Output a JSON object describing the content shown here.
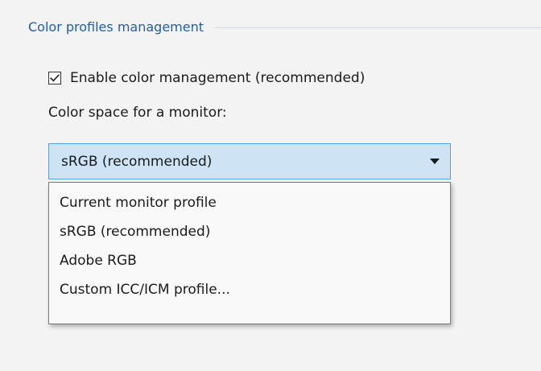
{
  "group": {
    "title": "Color profiles management"
  },
  "checkbox": {
    "label": "Enable color management (recommended)",
    "checked": true
  },
  "color_space": {
    "label": "Color space for a monitor:",
    "selected": "sRGB (recommended)",
    "options": [
      "Current monitor profile",
      "sRGB (recommended)",
      "Adobe RGB",
      "Custom ICC/ICM profile..."
    ]
  },
  "colors": {
    "accent_title": "#1f5fa8",
    "combo_background": "#cde4f7",
    "combo_border": "#5c9ed6",
    "background": "#f3f3f3"
  },
  "icons": {
    "checkbox": "checkmark-icon",
    "dropdown_arrow": "caret-down-icon"
  }
}
